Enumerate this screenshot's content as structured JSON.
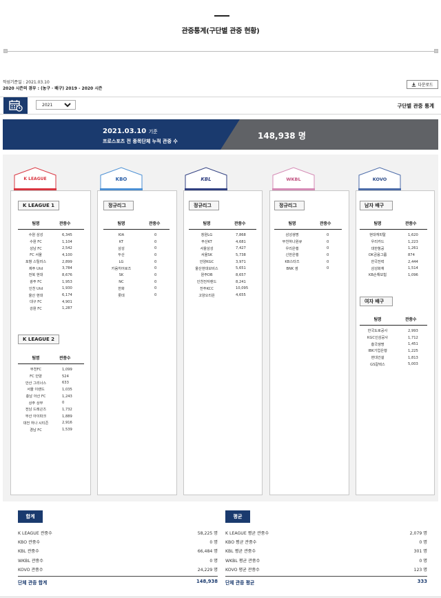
{
  "page": {
    "title_main": "관중통계",
    "title_sub": "(구단별 관중 현황)"
  },
  "meta": {
    "created": "작성기준일 : 2021.03.10",
    "season_note": "2020 시즌의 경우 : (농구 · 배구) 2019 - 2020 시즌"
  },
  "download": {
    "label": "다운로드",
    "icon": "download-icon"
  },
  "toolbar": {
    "calendar_icon": "calendar-icon",
    "year_selected": "2021",
    "right_title": "구단별 관중 통계"
  },
  "banner": {
    "date": "2021.03.10",
    "date_suffix": "기준",
    "subtitle": "프로스포츠 전 종목단체 누적 관중 수",
    "total": "148,938 명"
  },
  "colors": {
    "navy": "#1a3a6e",
    "kleague": "#d9343f",
    "kbo": "#4a8fd4",
    "kbl": "#2f3e80",
    "wkbl": "#d58ab5",
    "kovo": "#4a6aa8"
  },
  "table_header": {
    "team": "팀명",
    "count": "관중수"
  },
  "leagues": [
    {
      "logo": "K LEAGUE",
      "groups": [
        {
          "label": "K LEAGUE 1",
          "rows": [
            [
              "수원 삼성",
              "6,345"
            ],
            [
              "수원 FC",
              "1,104"
            ],
            [
              "성남 FC",
              "2,542"
            ],
            [
              "FC 서울",
              "4,100"
            ],
            [
              "포항 스틸러스",
              "2,899"
            ],
            [
              "제주 Utd",
              "3,784"
            ],
            [
              "전북 현대",
              "8,676"
            ],
            [
              "광주 FC",
              "1,953"
            ],
            [
              "인천 Utd",
              "1,930"
            ],
            [
              "울산 현대",
              "6,174"
            ],
            [
              "대구 FC",
              "4,901"
            ],
            [
              "강원 FC",
              "1,287"
            ]
          ]
        },
        {
          "label": "K LEAGUE 2",
          "rows": [
            [
              "부천FC",
              "1,099"
            ],
            [
              "FC 안양",
              "524"
            ],
            [
              "안산 그리너스",
              "633"
            ],
            [
              "서울 이랜드",
              "1,035"
            ],
            [
              "충남 아산 FC",
              "1,243"
            ],
            [
              "상주 상무",
              "0"
            ],
            [
              "전남 드래곤즈",
              "1,732"
            ],
            [
              "부산 아이파크",
              "1,889"
            ],
            [
              "대전 하나 시티즌",
              "2,916"
            ],
            [
              "경남 FC",
              "1,539"
            ]
          ]
        }
      ]
    },
    {
      "logo": "KBO",
      "groups": [
        {
          "label": "정규리그",
          "rows": [
            [
              "KIA",
              "0"
            ],
            [
              "KT",
              "0"
            ],
            [
              "삼성",
              "0"
            ],
            [
              "두산",
              "0"
            ],
            [
              "LG",
              "0"
            ],
            [
              "키움히어로즈",
              "0"
            ],
            [
              "SK",
              "0"
            ],
            [
              "NC",
              "0"
            ],
            [
              "한화",
              "0"
            ],
            [
              "롯데",
              "0"
            ]
          ]
        }
      ]
    },
    {
      "logo": "KBL",
      "groups": [
        {
          "label": "정규리그",
          "rows": [
            [
              "창원LG",
              "7,868"
            ],
            [
              "부산KT",
              "4,681"
            ],
            [
              "서울삼성",
              "7,427"
            ],
            [
              "서울SK",
              "5,738"
            ],
            [
              "안양KGC",
              "3,971"
            ],
            [
              "울산현대모비스",
              "5,651"
            ],
            [
              "원주DB",
              "8,657"
            ],
            [
              "인천전자랜드",
              "8,241"
            ],
            [
              "전주KCC",
              "10,095"
            ],
            [
              "고양오리온",
              "4,655"
            ]
          ]
        }
      ]
    },
    {
      "logo": "WKBL",
      "groups": [
        {
          "label": "정규리그",
          "rows": [
            [
              "삼성생명",
              "0"
            ],
            [
              "부천하나원큐",
              "0"
            ],
            [
              "우리은행",
              "0"
            ],
            [
              "신한은행",
              "0"
            ],
            [
              "KB스타즈",
              "0"
            ],
            [
              "BNK 썸",
              "0"
            ]
          ]
        }
      ]
    },
    {
      "logo": "KOVO",
      "groups": [
        {
          "label": "남자 배구",
          "rows": [
            [
              "현대캐피탈",
              "1,620"
            ],
            [
              "우리카드",
              "1,223"
            ],
            [
              "대한항공",
              "1,261"
            ],
            [
              "OK금융그룹",
              "874"
            ],
            [
              "한국전력",
              "2,444"
            ],
            [
              "삼성화재",
              "1,514"
            ],
            [
              "KB손해보험",
              "1,096"
            ]
          ]
        },
        {
          "label": "여자 배구",
          "rows": [
            [
              "한국도로공사",
              "2,993"
            ],
            [
              "KGC인삼공사",
              "1,712"
            ],
            [
              "흥국생명",
              "1,451"
            ],
            [
              "IBK기업은행",
              "1,225"
            ],
            [
              "현대건설",
              "1,813"
            ],
            [
              "GS칼텍스",
              "5,003"
            ]
          ]
        }
      ]
    }
  ],
  "summary": {
    "total": {
      "title": "합계",
      "rows": [
        [
          "K LEAGUE 관중수",
          "58,225 명"
        ],
        [
          "KBO 관중수",
          "0 명"
        ],
        [
          "KBL 관중수",
          "66,484 명"
        ],
        [
          "WKBL 관중수",
          "0 명"
        ],
        [
          "KOVO 관중수",
          "24,229 명"
        ]
      ],
      "footer": [
        "단체 관중 합계",
        "148,938"
      ]
    },
    "average": {
      "title": "평균",
      "rows": [
        [
          "K LEAGUE 평균 관중수",
          "2,079 명"
        ],
        [
          "KBO 평균 관중수",
          "0 명"
        ],
        [
          "KBL 평균 관중수",
          "301 명"
        ],
        [
          "WKBL 평균 관중수",
          "0 명"
        ],
        [
          "KOVO 평균 관중수",
          "123 명"
        ]
      ],
      "footer": [
        "단체 관중 평균",
        "333"
      ]
    }
  }
}
